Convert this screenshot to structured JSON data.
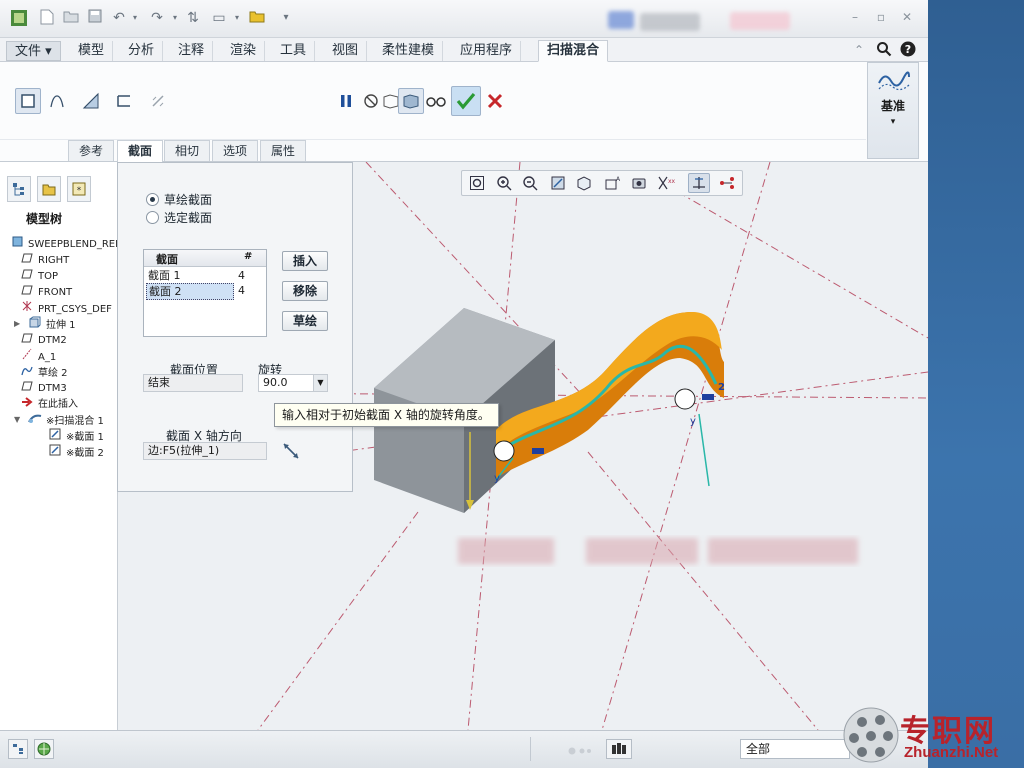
{
  "ribbon": {
    "tabs": [
      {
        "label": "文件",
        "type": "menu"
      },
      {
        "label": "模型"
      },
      {
        "label": "分析"
      },
      {
        "label": "注释"
      },
      {
        "label": "渲染"
      },
      {
        "label": "工具"
      },
      {
        "label": "视图"
      },
      {
        "label": "柔性建模"
      },
      {
        "label": "应用程序"
      },
      {
        "label": "扫描混合",
        "active": true
      }
    ],
    "sub_tabs": [
      "参考",
      "截面",
      "相切",
      "选项",
      "属性"
    ],
    "active_sub_tab": "截面",
    "datum_label": "基准"
  },
  "model_tree": {
    "title": "模型树",
    "items": [
      {
        "label": "SWEEPBLEND_REDE",
        "icon": "part-icon",
        "indent": 0
      },
      {
        "label": "RIGHT",
        "icon": "datum-plane-icon",
        "indent": 1
      },
      {
        "label": "TOP",
        "icon": "datum-plane-icon",
        "indent": 1
      },
      {
        "label": "FRONT",
        "icon": "datum-plane-icon",
        "indent": 1
      },
      {
        "label": "PRT_CSYS_DEF",
        "icon": "csys-icon",
        "indent": 1
      },
      {
        "label": "拉伸 1",
        "icon": "extrude-icon",
        "indent": 1,
        "expander": "▶"
      },
      {
        "label": "DTM2",
        "icon": "datum-plane-icon",
        "indent": 1
      },
      {
        "label": "A_1",
        "icon": "axis-icon",
        "indent": 1
      },
      {
        "label": "草绘 2",
        "icon": "sketch-icon",
        "indent": 1
      },
      {
        "label": "DTM3",
        "icon": "datum-plane-icon",
        "indent": 1
      },
      {
        "label": "在此插入",
        "icon": "insert-arrow-icon",
        "indent": 1
      },
      {
        "label": "※扫描混合 1",
        "icon": "sweepblend-icon",
        "indent": 1,
        "expander": "▼"
      },
      {
        "label": "※截面 1",
        "icon": "section-edit-icon",
        "indent": 2
      },
      {
        "label": "※截面 2",
        "icon": "section-edit-icon",
        "indent": 2
      }
    ]
  },
  "section_panel": {
    "radio_sketched": "草绘截面",
    "radio_selected": "选定截面",
    "table_header_name": "截面",
    "table_header_count": "#",
    "rows": [
      {
        "name": "截面 1",
        "count": "4"
      },
      {
        "name": "截面 2",
        "count": "4",
        "selected": true
      }
    ],
    "btn_insert": "插入",
    "btn_remove": "移除",
    "btn_sketch": "草绘",
    "position_label": "截面位置",
    "position_value": "结束",
    "rotation_label": "旋转",
    "rotation_value": "90.0",
    "xaxis_label": "截面 X 轴方向",
    "xaxis_value": "边:F5(拉伸_1)"
  },
  "tooltip": "输入相对于初始截面 X 轴的旋转角度。",
  "status": {
    "filter_value": "全部"
  },
  "watermark": {
    "cn": "专职网",
    "url": "Zhuanzhi.Net"
  },
  "colors": {
    "accent_orange": "#e8930f",
    "path_cyan": "#2ab7a8",
    "datum_red": "#b0354f",
    "box_gray": "#8e949a"
  }
}
